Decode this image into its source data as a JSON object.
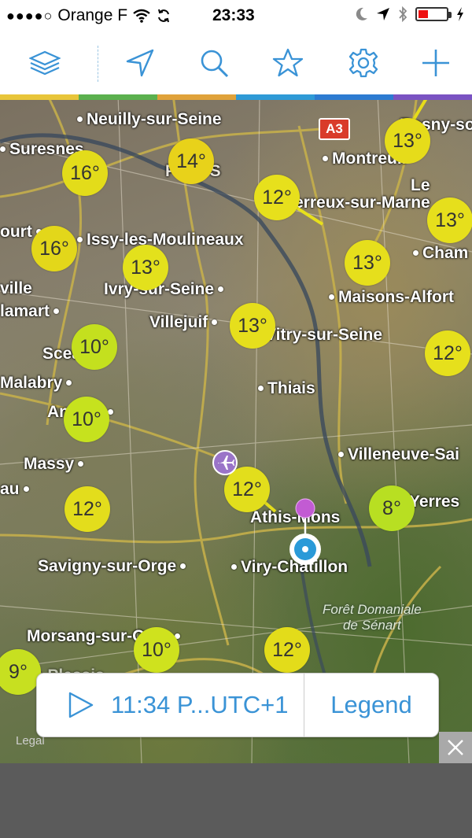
{
  "status": {
    "carrier": "Orange F",
    "time": "23:33"
  },
  "toolbar": {
    "items": [
      {
        "name": "layers-button",
        "icon": "layers-icon"
      },
      {
        "name": "location-button",
        "icon": "location-arrow-icon"
      },
      {
        "name": "search-button",
        "icon": "search-icon"
      },
      {
        "name": "favorites-button",
        "icon": "star-icon"
      },
      {
        "name": "settings-button",
        "icon": "gear-icon"
      },
      {
        "name": "add-button",
        "icon": "plus-icon"
      }
    ],
    "accent": "#3a93d6"
  },
  "colorbar": [
    "#e8c53a",
    "#5bb04e",
    "#e0a23a",
    "#2f9ad6",
    "#2d7bd1",
    "#7a53c2"
  ],
  "map": {
    "shield": "A3",
    "places": [
      {
        "id": "neuilly",
        "name": "Neuilly-sur-Seine"
      },
      {
        "id": "suresnes",
        "name": "Suresnes"
      },
      {
        "id": "paris",
        "name": "PARIS"
      },
      {
        "id": "montreuil",
        "name": "Montreuil"
      },
      {
        "id": "rosny",
        "name": "Rosny-so"
      },
      {
        "id": "le",
        "name": "Le"
      },
      {
        "id": "perreux",
        "name": "Perreux-sur-Marne"
      },
      {
        "id": "court",
        "name": "ourt"
      },
      {
        "id": "issy",
        "name": "Issy-les-Moulineaux"
      },
      {
        "id": "cham",
        "name": "Cham"
      },
      {
        "id": "ville",
        "name": "ville"
      },
      {
        "id": "ivry",
        "name": "Ivry-sur-Seine"
      },
      {
        "id": "maisons",
        "name": "Maisons-Alfort"
      },
      {
        "id": "clamart",
        "name": "lamart"
      },
      {
        "id": "villejuif",
        "name": "Villejuif"
      },
      {
        "id": "vitry",
        "name": "Vitry-sur-Seine"
      },
      {
        "id": "sceaux",
        "name": "Sceaux"
      },
      {
        "id": "thiais",
        "name": "Thiais"
      },
      {
        "id": "malabry",
        "name": "Malabry"
      },
      {
        "id": "antony",
        "name": "Antony"
      },
      {
        "id": "massy",
        "name": "Massy"
      },
      {
        "id": "villeneuve",
        "name": "Villeneuve-Sai"
      },
      {
        "id": "au",
        "name": "au"
      },
      {
        "id": "athis",
        "name": "Athis-Mons"
      },
      {
        "id": "yerres",
        "name": "Yerres"
      },
      {
        "id": "savigny",
        "name": "Savigny-sur-Orge"
      },
      {
        "id": "viry",
        "name": "Viry-Chatillon"
      },
      {
        "id": "morsang",
        "name": "Morsang-sur-Orge"
      },
      {
        "id": "plessis",
        "name": "Le Plessis"
      }
    ],
    "forest": {
      "line1": "Forêt Domaniale",
      "line2": "de Sénart"
    },
    "temps": [
      {
        "id": "t1",
        "value": "16°",
        "color": "#e3dc1a"
      },
      {
        "id": "t2",
        "value": "14°",
        "color": "#e8d21a"
      },
      {
        "id": "t3",
        "value": "12°",
        "color": "#e7e01c"
      },
      {
        "id": "t4",
        "value": "13°",
        "color": "#e6dc1a"
      },
      {
        "id": "t5",
        "value": "16°",
        "color": "#e3d71a"
      },
      {
        "id": "t6",
        "value": "13°",
        "color": "#e3e11c"
      },
      {
        "id": "t7",
        "value": "13°",
        "color": "#e6df1c"
      },
      {
        "id": "t8",
        "value": "13°",
        "color": "#e6df1c"
      },
      {
        "id": "t9",
        "value": "10°",
        "color": "#c4e01e"
      },
      {
        "id": "t10",
        "value": "13°",
        "color": "#e6df1c"
      },
      {
        "id": "t11",
        "value": "12°",
        "color": "#e6e01c"
      },
      {
        "id": "t12",
        "value": "10°",
        "color": "#c6e21e"
      },
      {
        "id": "t13",
        "value": "12°",
        "color": "#e2de1c"
      },
      {
        "id": "t14",
        "value": "12°",
        "color": "#e3dd1c"
      },
      {
        "id": "t15",
        "value": "8°",
        "color": "#b8df22"
      },
      {
        "id": "t16",
        "value": "9°",
        "color": "#c7e020"
      },
      {
        "id": "t17",
        "value": "10°",
        "color": "#cfe21e"
      },
      {
        "id": "t18",
        "value": "12°",
        "color": "#e3dc1a"
      }
    ],
    "legal": "Legal"
  },
  "panel": {
    "time_label": "11:34 P...UTC+1",
    "legend_label": "Legend"
  }
}
